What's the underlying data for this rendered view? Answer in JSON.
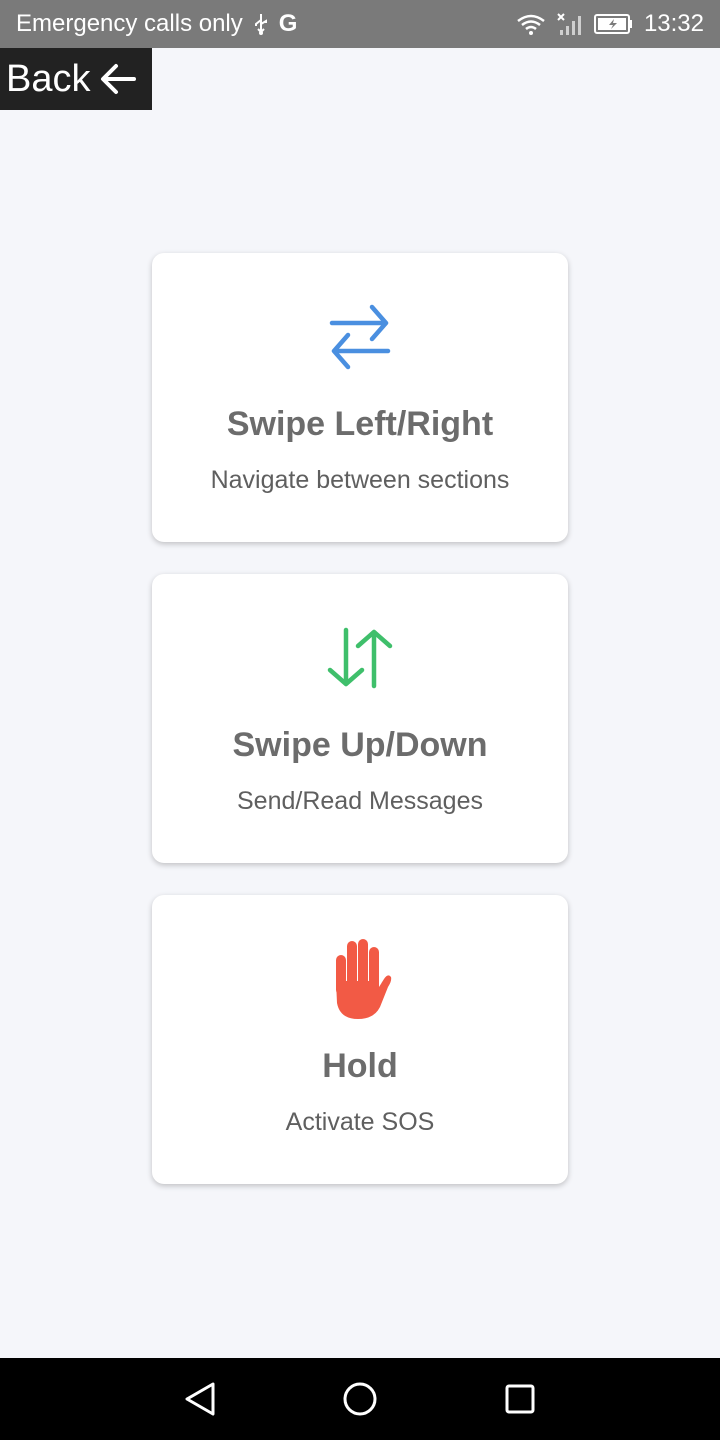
{
  "status_bar": {
    "left_text": "Emergency calls only",
    "usb_icon": "usb-icon",
    "google_icon": "G",
    "time": "13:32",
    "icons": [
      "wifi-icon",
      "no-signal-icon",
      "battery-charging-icon"
    ]
  },
  "header": {
    "back_label": "Back",
    "back_icon": "arrow-left-icon"
  },
  "cards": [
    {
      "icon": "arrows-left-right-icon",
      "icon_color": "#4a8fe0",
      "title": "Swipe Left/Right",
      "description": "Navigate between sections"
    },
    {
      "icon": "arrows-up-down-icon",
      "icon_color": "#3fbf6b",
      "title": "Swipe Up/Down",
      "description": "Send/Read Messages"
    },
    {
      "icon": "hand-icon",
      "icon_color": "#f25a45",
      "title": "Hold",
      "description": "Activate SOS"
    }
  ],
  "nav_bar": {
    "buttons": [
      "back-triangle-icon",
      "home-circle-icon",
      "recents-square-icon"
    ]
  }
}
